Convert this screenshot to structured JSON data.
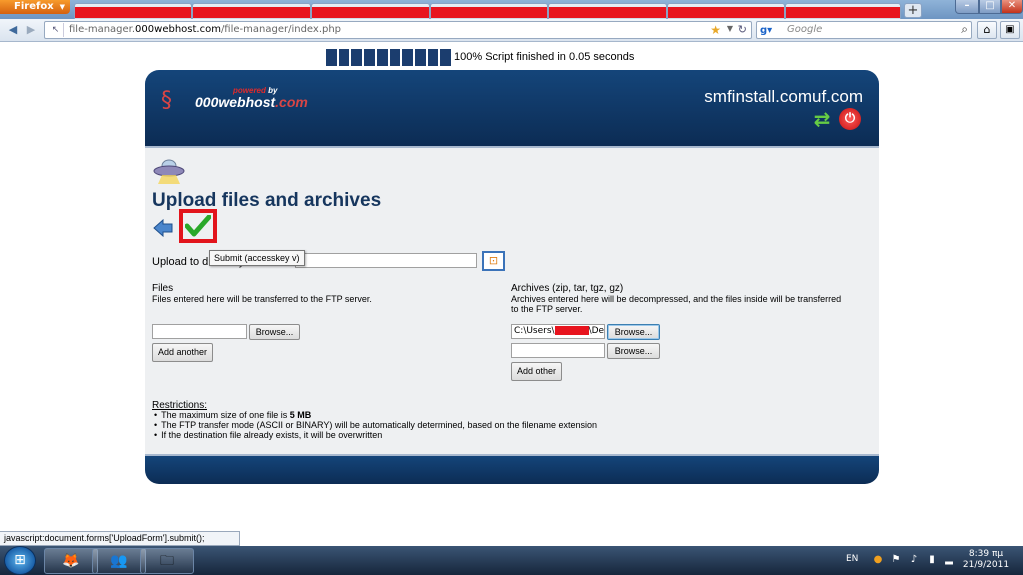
{
  "browser": {
    "app_button": "Firefox",
    "new_tab_label": "+",
    "url_host": "file-manager.",
    "url_domain": "000webhost.com",
    "url_path": "/file-manager/index.php",
    "search_engine": "Google",
    "search_placeholder": "Google",
    "status_text": "javascript:document.forms['UploadForm'].submit();"
  },
  "progress": {
    "segments": 10,
    "percent": 100,
    "text": "100% Script finished in 0.05 seconds"
  },
  "header": {
    "powered_label": "powered",
    "by_label": "by",
    "logo_main": "000webhost",
    "logo_suffix": ".com",
    "site_name": "smfinstall.comuf.com"
  },
  "main": {
    "title": "Upload files and archives",
    "tooltip": "Submit (accesskey v)",
    "upload_dir_label": "Upload to directory:",
    "files": {
      "title": "Files",
      "description": "Files entered here will be transferred to the FTP server.",
      "browse_label": "Browse...",
      "add_label": "Add another"
    },
    "archives": {
      "title": "Archives (zip, tar, tgz, gz)",
      "description_line1": "Archives entered here will be decompressed, and the files inside will be transferred",
      "description_line2": "to the FTP server.",
      "file1_prefix": "C:\\Users\\",
      "file1_suffix": "\\Deskto",
      "browse_label": "Browse...",
      "add_label": "Add other"
    },
    "restrictions": {
      "title": "Restrictions:",
      "item1_prefix": "The maximum size of one file is ",
      "item1_bold": "5 MB",
      "item2": "The FTP transfer mode (ASCII or BINARY) will be automatically determined, based on the filename extension",
      "item3": "If the destination file already exists, it will be overwritten"
    }
  },
  "taskbar": {
    "lang": "EN",
    "time": "8:39 πμ",
    "date": "21/9/2011"
  },
  "colors": {
    "header_blue": "#0c2c54",
    "title_blue": "#16365e",
    "highlight_red": "#e2141c"
  }
}
